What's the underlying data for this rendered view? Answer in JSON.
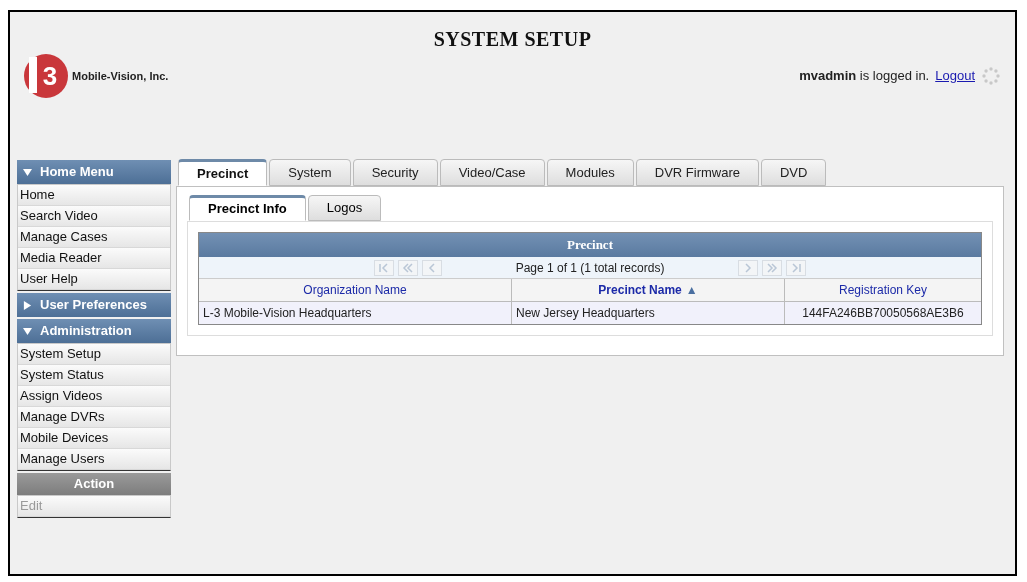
{
  "header": {
    "title": "SYSTEM SETUP",
    "company": "Mobile-Vision, Inc.",
    "logo_text": "3",
    "user": "mvadmin",
    "logged_in_text": "is logged in.",
    "logout": "Logout"
  },
  "sidebar": {
    "sections": [
      {
        "kind": "menu",
        "title": "Home Menu",
        "expanded": true,
        "items": [
          {
            "label": "Home",
            "disabled": false
          },
          {
            "label": "Search Video",
            "disabled": false
          },
          {
            "label": "Manage Cases",
            "disabled": false
          },
          {
            "label": "Media Reader",
            "disabled": false
          },
          {
            "label": "User Help",
            "disabled": false
          }
        ]
      },
      {
        "kind": "menu",
        "title": "User Preferences",
        "expanded": false
      },
      {
        "kind": "menu",
        "title": "Administration",
        "expanded": true,
        "items": [
          {
            "label": "System Setup",
            "disabled": false
          },
          {
            "label": "System Status",
            "disabled": false
          },
          {
            "label": "Assign Videos",
            "disabled": false
          },
          {
            "label": "Manage DVRs",
            "disabled": false
          },
          {
            "label": "Mobile Devices",
            "disabled": false
          },
          {
            "label": "Manage Users",
            "disabled": false
          }
        ]
      },
      {
        "kind": "action",
        "title": "Action",
        "items": [
          {
            "label": "Edit",
            "disabled": true
          }
        ]
      }
    ]
  },
  "tabs": [
    {
      "label": "Precinct",
      "selected": true
    },
    {
      "label": "System",
      "selected": false
    },
    {
      "label": "Security",
      "selected": false
    },
    {
      "label": "Video/Case",
      "selected": false
    },
    {
      "label": "Modules",
      "selected": false
    },
    {
      "label": "DVR Firmware",
      "selected": false
    },
    {
      "label": "DVD",
      "selected": false
    }
  ],
  "subtabs": [
    {
      "label": "Precinct Info",
      "selected": true
    },
    {
      "label": "Logos",
      "selected": false
    }
  ],
  "table": {
    "title": "Precinct",
    "pager": {
      "text": "Page 1 of 1 (1 total records)",
      "disabled": true
    },
    "columns": [
      {
        "label": "Organization Name",
        "sorted": false
      },
      {
        "label": "Precinct Name",
        "sorted": true,
        "sort_mark": "▲"
      },
      {
        "label": "Registration Key",
        "sorted": false
      }
    ],
    "rows": [
      [
        "L-3 Mobile-Vision Headquarters",
        "New Jersey Headquarters",
        "144FA246BB70050568AE3B6"
      ]
    ]
  }
}
